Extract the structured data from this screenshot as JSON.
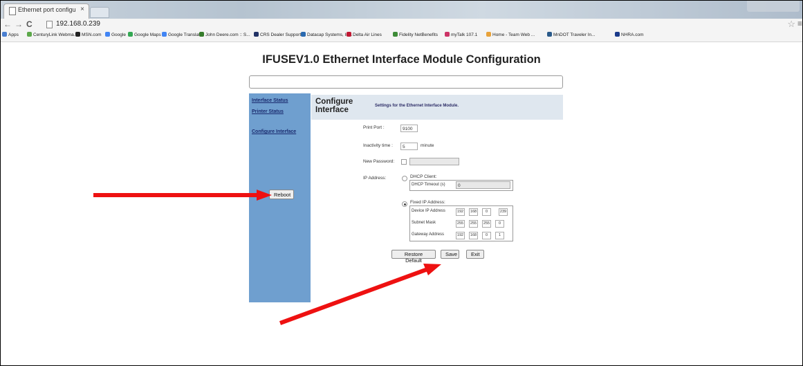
{
  "browser": {
    "tab_title": "Ethernet port configuratio",
    "tab_close": "×",
    "url": "192.168.0.239",
    "back_glyph": "←",
    "forward_glyph": "→",
    "reload_glyph": "C",
    "star_glyph": "☆",
    "menu_glyph": "≡",
    "bookmarks": [
      {
        "label": "Apps",
        "color": "#4a7fd0"
      },
      {
        "label": "CenturyLink Webma...",
        "color": "#5ca84a"
      },
      {
        "label": "MSN.com",
        "color": "#222222"
      },
      {
        "label": "Google",
        "color": "#4285f4"
      },
      {
        "label": "Google Maps",
        "color": "#34a853"
      },
      {
        "label": "Google Translate",
        "color": "#4285f4"
      },
      {
        "label": "John Deere.com :: S...",
        "color": "#367c2b"
      },
      {
        "label": "CRS Dealer Support ...",
        "color": "#223366"
      },
      {
        "label": "Datacap Systems, Inc.",
        "color": "#2a6ab0"
      },
      {
        "label": "Delta Air Lines",
        "color": "#c01933"
      },
      {
        "label": "Fidelity NetBenefits",
        "color": "#3d8b37"
      },
      {
        "label": "myTalk 107.1",
        "color": "#cc3366"
      },
      {
        "label": "Home - Team Web ...",
        "color": "#e8a23a"
      },
      {
        "label": "MnDOT Traveler In...",
        "color": "#2a5a8a"
      },
      {
        "label": "NHRA.com",
        "color": "#1a3a8a"
      }
    ]
  },
  "page": {
    "title": "IFUSEV1.0 Ethernet Interface Module Configuration",
    "sidebar": {
      "links": [
        "Interface Status",
        "Printer Status",
        "Configure Interface"
      ],
      "reboot_label": "Reboot",
      "bg_color": "#6f9fcf"
    },
    "header": {
      "title": "Configure Interface",
      "subtitle": "Settings for the Ethernet Interface Module."
    },
    "form": {
      "print_port_label": "Print Port :",
      "print_port_value": "9100",
      "inactivity_label": "Inactivity time :",
      "inactivity_value": "5",
      "inactivity_unit": "minute",
      "new_password_label": "New Password:",
      "new_password_checked": false,
      "ip_address_label": "IP Address:",
      "dhcp_label": "DHCP Client:",
      "dhcp_selected": false,
      "dhcp_timeout_label": "DHCP Timeout (s)",
      "dhcp_timeout_value": "0",
      "fixed_label": "Fixed IP Address:",
      "fixed_selected": true,
      "device_ip_label": "Device IP Address",
      "device_ip": [
        "192",
        "168",
        "0",
        "239"
      ],
      "subnet_label": "Subnet Mask",
      "subnet": [
        "255",
        "255",
        "255",
        "0"
      ],
      "gateway_label": "Gateway Address",
      "gateway": [
        "192",
        "168",
        "0",
        "1"
      ]
    },
    "buttons": {
      "restore": "Restore Default",
      "save": "Save",
      "exit": "Exit"
    }
  },
  "annotations": {
    "arrow_color": "#ee1111"
  }
}
